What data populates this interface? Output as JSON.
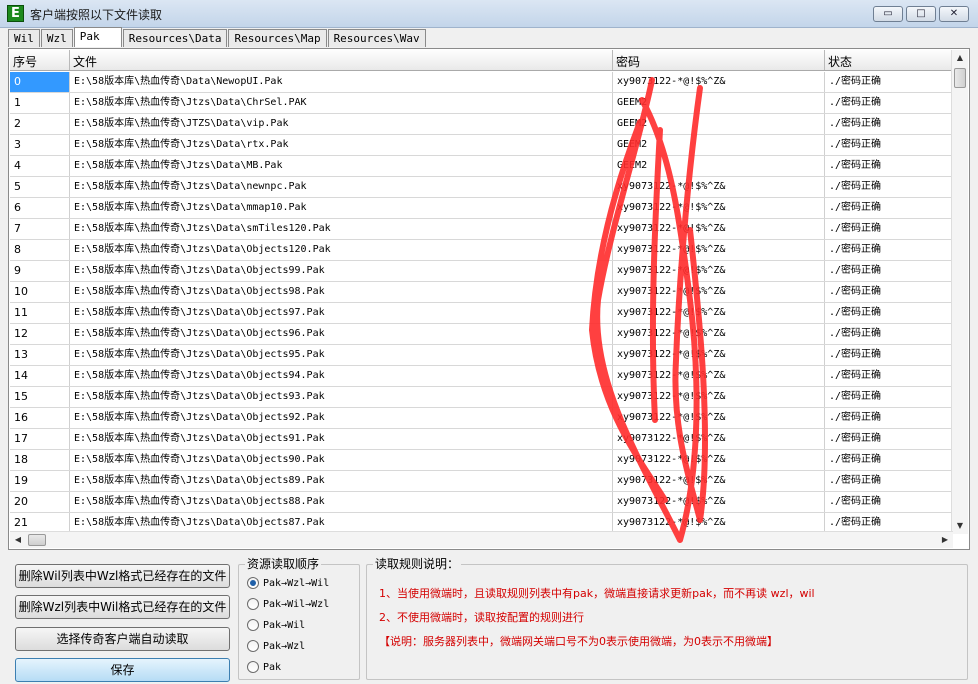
{
  "window": {
    "title": "客户端按照以下文件读取",
    "app_icon_letter": "E",
    "minimize_glyph": "▭",
    "maximize_glyph": "□",
    "close_glyph": "✕"
  },
  "tabs": [
    "Wil",
    "Wzl",
    "Pak",
    "Resources\\Data",
    "Resources\\Map",
    "Resources\\Wav"
  ],
  "active_tab": "Pak",
  "grid": {
    "headers": [
      "序号",
      "文件",
      "密码",
      "状态"
    ],
    "rows": [
      [
        "0",
        "E:\\58版本库\\热血传奇\\Data\\NewopUI.Pak",
        "xy9073122-*@!$%^Z&",
        "./密码正确"
      ],
      [
        "1",
        "E:\\58版本库\\热血传奇\\Jtzs\\Data\\ChrSel.PAK",
        "GEEM2",
        "./密码正确"
      ],
      [
        "2",
        "E:\\58版本库\\热血传奇\\JTZS\\Data\\vip.Pak",
        "GEEM2",
        "./密码正确"
      ],
      [
        "3",
        "E:\\58版本库\\热血传奇\\Jtzs\\Data\\rtx.Pak",
        "GEEM2",
        "./密码正确"
      ],
      [
        "4",
        "E:\\58版本库\\热血传奇\\Jtzs\\Data\\MB.Pak",
        "GEEM2",
        "./密码正确"
      ],
      [
        "5",
        "E:\\58版本库\\热血传奇\\Jtzs\\Data\\newnpc.Pak",
        "xy9073122-*@!$%^Z&",
        "./密码正确"
      ],
      [
        "6",
        "E:\\58版本库\\热血传奇\\Jtzs\\Data\\mmap10.Pak",
        "xy9073122-*@!$%^Z&",
        "./密码正确"
      ],
      [
        "7",
        "E:\\58版本库\\热血传奇\\Jtzs\\Data\\smTiles120.Pak",
        "xy9073122-*@!$%^Z&",
        "./密码正确"
      ],
      [
        "8",
        "E:\\58版本库\\热血传奇\\Jtzs\\Data\\Objects120.Pak",
        "xy9073122-*@!$%^Z&",
        "./密码正确"
      ],
      [
        "9",
        "E:\\58版本库\\热血传奇\\Jtzs\\Data\\Objects99.Pak",
        "xy9073122-*@!$%^Z&",
        "./密码正确"
      ],
      [
        "10",
        "E:\\58版本库\\热血传奇\\Jtzs\\Data\\Objects98.Pak",
        "xy9073122-*@!$%^Z&",
        "./密码正确"
      ],
      [
        "11",
        "E:\\58版本库\\热血传奇\\Jtzs\\Data\\Objects97.Pak",
        "xy9073122-*@!$%^Z&",
        "./密码正确"
      ],
      [
        "12",
        "E:\\58版本库\\热血传奇\\Jtzs\\Data\\Objects96.Pak",
        "xy9073122-*@!$%^Z&",
        "./密码正确"
      ],
      [
        "13",
        "E:\\58版本库\\热血传奇\\Jtzs\\Data\\Objects95.Pak",
        "xy9073122-*@!$%^Z&",
        "./密码正确"
      ],
      [
        "14",
        "E:\\58版本库\\热血传奇\\Jtzs\\Data\\Objects94.Pak",
        "xy9073122-*@!$%^Z&",
        "./密码正确"
      ],
      [
        "15",
        "E:\\58版本库\\热血传奇\\Jtzs\\Data\\Objects93.Pak",
        "xy9073122-*@!$%^Z&",
        "./密码正确"
      ],
      [
        "16",
        "E:\\58版本库\\热血传奇\\Jtzs\\Data\\Objects92.Pak",
        "xy9073122-*@!$%^Z&",
        "./密码正确"
      ],
      [
        "17",
        "E:\\58版本库\\热血传奇\\Jtzs\\Data\\Objects91.Pak",
        "xy9073122-*@!$%^Z&",
        "./密码正确"
      ],
      [
        "18",
        "E:\\58版本库\\热血传奇\\Jtzs\\Data\\Objects90.Pak",
        "xy9073122-*@!$%^Z&",
        "./密码正确"
      ],
      [
        "19",
        "E:\\58版本库\\热血传奇\\Jtzs\\Data\\Objects89.Pak",
        "xy9073122-*@!$%^Z&",
        "./密码正确"
      ],
      [
        "20",
        "E:\\58版本库\\热血传奇\\Jtzs\\Data\\Objects88.Pak",
        "xy9073122-*@!$%^Z&",
        "./密码正确"
      ],
      [
        "21",
        "E:\\58版本库\\热血传奇\\Jtzs\\Data\\Objects87.Pak",
        "xy9073122-*@!$%^Z&",
        "./密码正确"
      ]
    ],
    "selected_row": 0
  },
  "buttons": {
    "delete_wil": "删除Wil列表中Wzl格式已经存在的文件",
    "delete_wzl": "删除Wzl列表中Wil格式已经存在的文件",
    "select_client": "选择传奇客户端自动读取",
    "save": "保存"
  },
  "read_order": {
    "title": "资源读取顺序",
    "options": [
      "Pak→Wzl→Wil",
      "Pak→Wil→Wzl",
      "Pak→Wil",
      "Pak→Wzl",
      "Pak"
    ],
    "selected": 0
  },
  "rules": {
    "title": "读取规则说明：",
    "lines": [
      "1、当使用微端时，且读取规则列表中有pak，微端直接请求更新pak，而不再读 wzl，wil",
      "2、不使用微端时，读取按配置的规则进行",
      "【说明：服务器列表中，微端网关端口号不为0表示使用微端，为0表示不用微端】"
    ]
  },
  "colors": {
    "selection": "#3399ff",
    "rules_text": "#d40000",
    "scribble": "#ff2b2b"
  }
}
